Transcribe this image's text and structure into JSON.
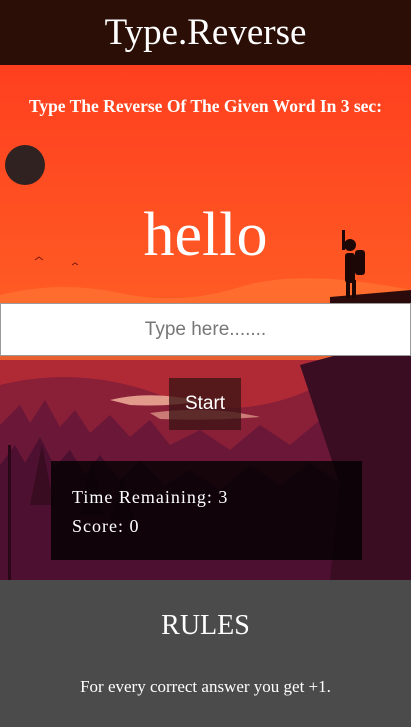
{
  "app": {
    "title": "Type.Reverse"
  },
  "game": {
    "instruction": "Type The Reverse Of The Given Word In 3 sec:",
    "word": "hello",
    "input_placeholder": "Type here.......",
    "input_value": "",
    "start_label": "Start"
  },
  "stats": {
    "time_label": "Time Remaining:",
    "time_value": "3",
    "score_label": "Score:",
    "score_value": "0"
  },
  "rules": {
    "title": "RULES",
    "text": "For every correct answer you get +1."
  },
  "colors": {
    "header_bg": "#2b0f07",
    "sky": "#ff4a22",
    "forest_dark": "#3a0d1e",
    "rules_bg": "#4b4b4b"
  }
}
